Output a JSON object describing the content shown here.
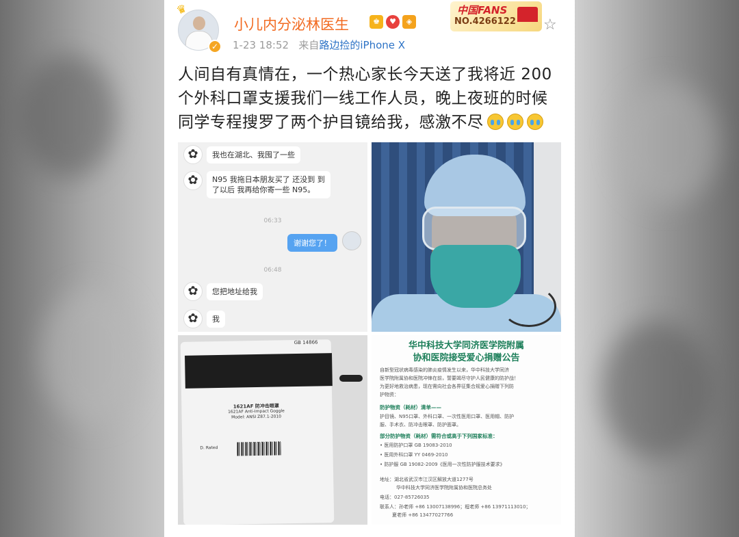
{
  "user": {
    "name": "小儿内分泌林医生",
    "timestamp": "1-23 18:52",
    "source_prefix": "来自",
    "source": "路边捡的iPhone X"
  },
  "fans_badge": {
    "title": "中国FANS",
    "number": "NO.4266122"
  },
  "post": {
    "line1": "人间自有真情在，一个热心家长今天送了我将近 200",
    "line2": "个外科口罩支援我们一线工作人员，晚上夜班的时候",
    "line3": "同学专程搜罗了两个护目镜给我，感激不尽"
  },
  "chat": {
    "msg1": "我也在湖北、我囤了一些",
    "msg2_a": "N95 我拖日本朋友买了 还没到 到",
    "msg2_b": "了以后 我再给你寄一些 N95。",
    "time1": "06:33",
    "reply": "谢谢您了！",
    "time2": "06:48",
    "msg3": "您把地址给我",
    "msg4": "我"
  },
  "package": {
    "top_label": "GB 14866",
    "line1": "1621AF 防冲击眼罩",
    "line2": "1621AF Anti-Impact Goggle",
    "line3": "Model: ANSI Z87.1-2010",
    "barcode_text": "D. Rated"
  },
  "notice": {
    "title1": "华中科技大学同济医学院附属",
    "title2": "协和医院接受爱心捐赠公告",
    "intro1": "自新型冠状病毒感染的肺炎疫情发生以来，华中科技大学同济",
    "intro2": "医学院附属协和医院冲锋在前，誓要竭尽守护人民健康的防护战！",
    "intro3": "为更好地救治病患，现在需向社会各界征集合规爱心捐赠下列防",
    "intro4": "护物资：",
    "list_h": "防护物资（耗材）清单——",
    "list1": "护目镜、N95口罩、外科口罩、一次性医用口罩、医用帽、防护",
    "list2": "服、手术衣、防冲击眼罩、防护面罩。",
    "std_h": "部分防护物资（耗材）需符合或高于下列国家标准：",
    "std1": "• 医用防护口罩 GB 19083-2010",
    "std2": "• 医用外科口罩 YY 0469-2010",
    "std3": "• 防护服 GB 19082-2009《医用一次性防护服技术要求》",
    "addr1": "地址：湖北省武汉市江汉区解放大道1277号",
    "addr2": "华中科技大学同济医学院附属协和医院总务处",
    "phone": "电话：027-85726035",
    "contact1": "联系人：孙老师 +86 13007138996；程老师 +86 13971113010；",
    "contact2": "夏老师 +86 13477027766"
  }
}
